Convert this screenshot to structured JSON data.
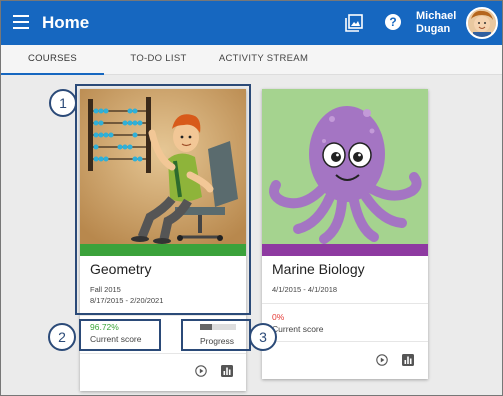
{
  "app": {
    "title": "Home",
    "user_name_line1": "Michael",
    "user_name_line2": "Dugan"
  },
  "tabs": [
    {
      "label": "COURSES",
      "active": true
    },
    {
      "label": "TO-DO LIST",
      "active": false
    },
    {
      "label": "ACTIVITY STREAM",
      "active": false
    }
  ],
  "courses": [
    {
      "title": "Geometry",
      "term": "Fall 2015",
      "dates": "8/17/2015 - 2/20/2021",
      "score": "96.72%",
      "score_label": "Current score",
      "progress_label": "Progress",
      "progress_fraction": 0.33,
      "score_color": "#3aa63a",
      "stripe_color": "#3ba23b"
    },
    {
      "title": "Marine Biology",
      "dates": "4/1/2015 - 4/1/2018",
      "score": "0%",
      "score_label": "Current score",
      "score_color": "#e53935",
      "stripe_color": "#8e3aa1"
    }
  ],
  "callouts": [
    "1",
    "2",
    "3"
  ],
  "icons": {
    "menu": "menu-icon",
    "gallery": "gallery-icon",
    "help": "help-icon",
    "play": "play-icon",
    "chart": "chart-icon"
  },
  "colors": {
    "appbar": "#1667c0",
    "callout": "#2b4a78"
  }
}
